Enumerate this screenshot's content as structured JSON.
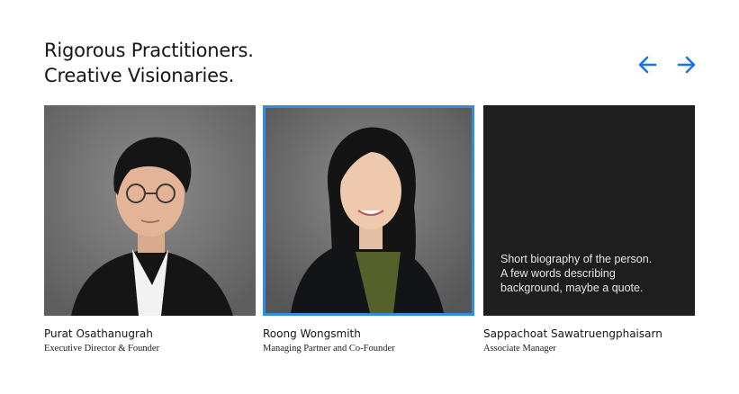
{
  "header": {
    "line1": "Rigorous Practitioners.",
    "line2": "Creative Visionaries."
  },
  "carousel": {
    "prev_icon": "arrow-left-icon",
    "next_icon": "arrow-right-icon",
    "accent_color": "#1a73e8",
    "selected_border_color": "#2f8ee0"
  },
  "team": [
    {
      "name": "Purat Osathanugrah",
      "role": "Executive Director & Founder"
    },
    {
      "name": "Roong Wongsmith",
      "role": "Managing Partner and Co-Founder"
    },
    {
      "name": "Sappachoat Sawatruengphaisarn",
      "role": "Associate Manager",
      "bio_lines": [
        "Short biography of the person.",
        "A few words describing",
        "background, maybe a quote."
      ]
    }
  ]
}
